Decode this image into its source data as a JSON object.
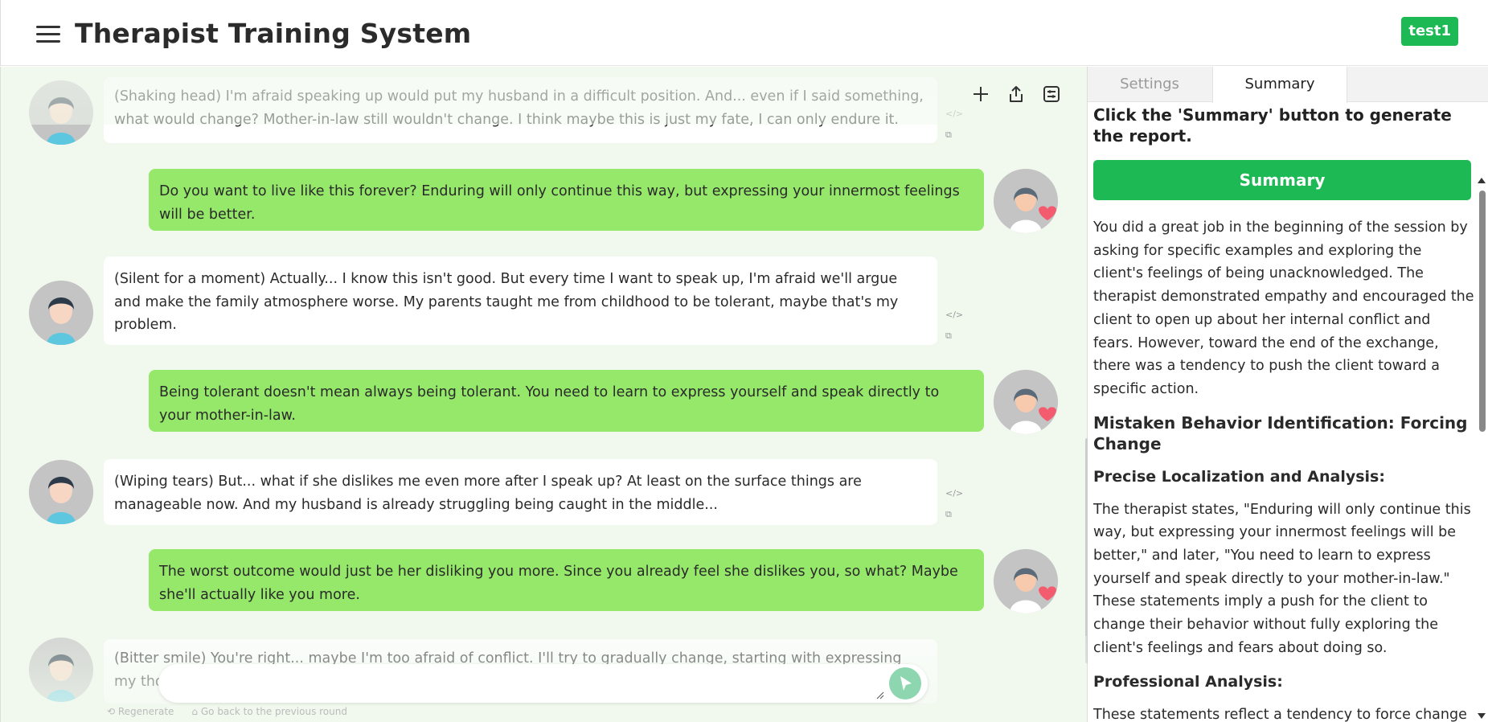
{
  "header": {
    "title": "Therapist Training System",
    "user": "test1"
  },
  "chat": {
    "messages": [
      {
        "role": "client",
        "text": "(Shaking head) I'm afraid speaking up would put my husband in a difficult position. And... even if I said something, what would change? Mother-in-law still wouldn't change. I think maybe this is just my fate, I can only endure it."
      },
      {
        "role": "therapist",
        "text": "Do you want to live like this forever? Enduring will only continue this way, but expressing your innermost feelings will be better."
      },
      {
        "role": "client",
        "text": "(Silent for a moment) Actually... I know this isn't good. But every time I want to speak up, I'm afraid we'll argue and make the family atmosphere worse. My parents taught me from childhood to be tolerant, maybe that's my problem."
      },
      {
        "role": "therapist",
        "text": "Being tolerant doesn't mean always being tolerant. You need to learn to express yourself and speak directly to your mother-in-law."
      },
      {
        "role": "client",
        "text": "(Wiping tears) But... what if she dislikes me even more after I speak up? At least on the surface things are manageable now. And my husband is already struggling being caught in the middle..."
      },
      {
        "role": "therapist",
        "text": "The worst outcome would just be her disliking you more. Since you already feel she dislikes you, so what? Maybe she'll actually like you more."
      },
      {
        "role": "client",
        "text": "(Bitter smile) You're right... maybe I'm too afraid of conflict. I'll try to gradually change, starting with expressing my thoughts in small things. Thank you for listening to me talk so much today."
      }
    ],
    "regenerate": "Regenerate",
    "go_back": "Go back to the previous round",
    "input_placeholder": ""
  },
  "panel": {
    "tabs": [
      "Settings",
      "Summary"
    ],
    "active_tab": "Summary",
    "prompt": "Click the 'Summary' button to generate the report.",
    "summary_button": "Summary",
    "report": {
      "intro": "You did a great job in the beginning of the session by asking for specific examples and exploring the client's feelings of being unacknowledged. The therapist demonstrated empathy and encouraged the client to open up about her internal conflict and fears. However, toward the end of the exchange, there was a tendency to push the client toward a specific action.",
      "heading1": "Mistaken Behavior Identification: Forcing Change",
      "sub1": "Precise Localization and Analysis:",
      "para1": "The therapist states, \"Enduring will only continue this way, but expressing your innermost feelings will be better,\" and later, \"You need to learn to express yourself and speak directly to your mother-in-law.\" These statements imply a push for the client to change their behavior without fully exploring the client's feelings and fears about doing so.",
      "sub2": "Professional Analysis:",
      "para2": "These statements reflect a tendency to force change"
    }
  },
  "colors": {
    "accent_green": "#1db954",
    "therapist_bubble": "#95e86a",
    "chat_bg": "#f1f9ef"
  }
}
